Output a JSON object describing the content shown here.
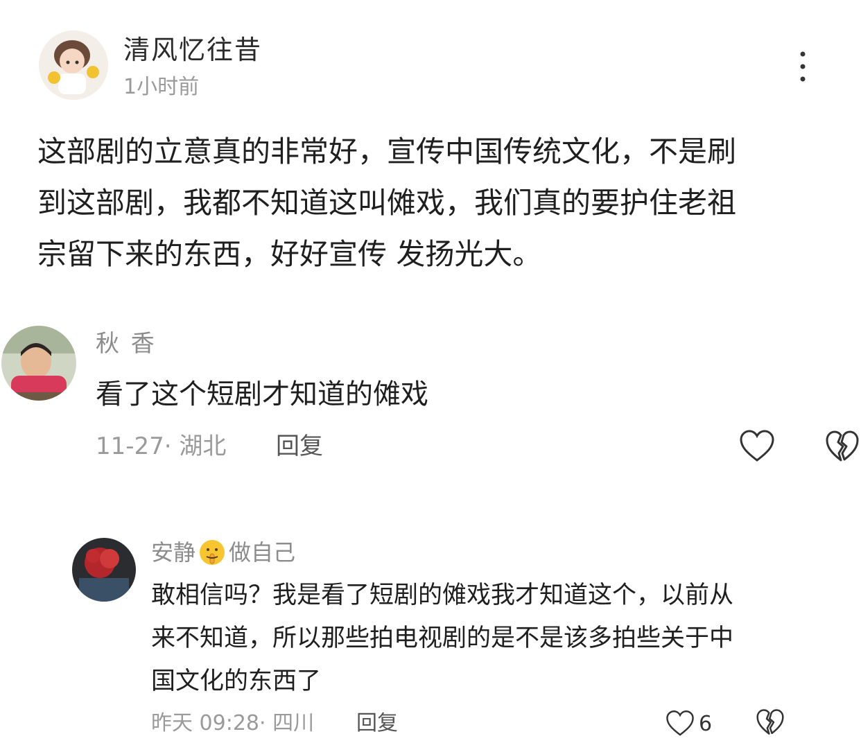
{
  "post": {
    "author": "清风忆往昔",
    "time": "1小时前",
    "body_lines": [
      "这部剧的立意真的非常好，宣传中国传统文化，不是刷",
      "到这部剧，我都不知道这叫傩戏，我们真的要护住老祖",
      "宗留下来的东西，好好宣传 发扬光大。"
    ]
  },
  "comment1": {
    "author": "秋 香",
    "text": "看了这个短剧才知道的傩戏",
    "date": "11-27",
    "location": "湖北",
    "meta_sep": "·",
    "reply_label": "回复"
  },
  "comment2": {
    "author_part1": "安静",
    "author_part2": "做自己",
    "text_lines": [
      "敢相信吗？我是看了短剧的傩戏我才知道这个，以前从",
      "来不知道，所以那些拍电视剧的是不是该多拍些关于中",
      "国文化的东西了"
    ],
    "date": "昨天 09:28",
    "location": "四川",
    "meta_sep": "·",
    "reply_label": "回复",
    "like_count": "6"
  },
  "icons": {
    "more": "more-vertical-icon",
    "like": "heart-outline-icon",
    "dislike": "broken-heart-icon",
    "emoji": "shushing-face-emoji-icon"
  }
}
